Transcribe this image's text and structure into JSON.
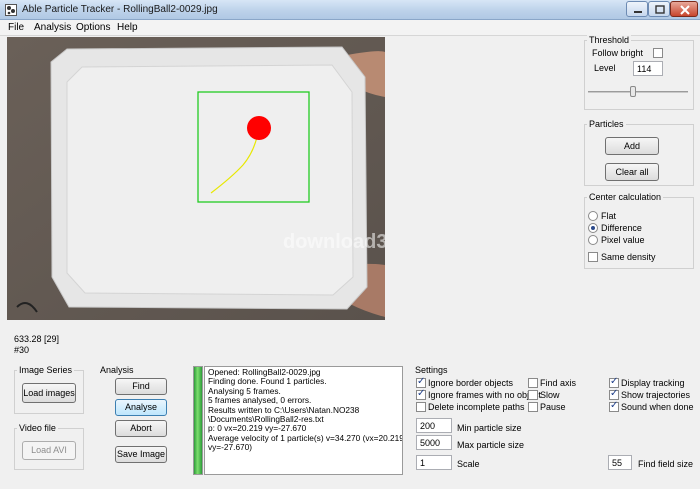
{
  "window": {
    "title": "Able Particle Tracker - RollingBall2-0029.jpg",
    "icon": "app-icon"
  },
  "menu": {
    "items": [
      "File",
      "Analysis",
      "Options",
      "Help"
    ]
  },
  "video": {
    "watermark": "download3k",
    "info_time": "633.28 [29]",
    "info_frame": "#30"
  },
  "threshold": {
    "title": "Threshold",
    "follow_bright_label": "Follow bright",
    "follow_bright_checked": false,
    "level_label": "Level",
    "level_value": "114"
  },
  "particles": {
    "title": "Particles",
    "add_label": "Add",
    "clear_label": "Clear all"
  },
  "center_calc": {
    "title": "Center calculation",
    "options": [
      "Flat",
      "Difference",
      "Pixel value"
    ],
    "selected": "Difference",
    "same_density_label": "Same density",
    "same_density_checked": false
  },
  "image_series": {
    "title": "Image Series",
    "load_label": "Load images"
  },
  "video_file": {
    "title": "Video file",
    "load_label": "Load AVI"
  },
  "analysis": {
    "title": "Analysis",
    "find_label": "Find",
    "analyse_label": "Analyse",
    "abort_label": "Abort",
    "save_label": "Save Image"
  },
  "log_lines": [
    "Opened: RollingBall2-0029.jpg",
    "Finding done. Found 1 particles.",
    "Analysing 5 frames.",
    "5 frames analysed, 0 errors.",
    "Results written to C:\\Users\\Natan.NO238",
    "\\Documents\\RollingBall2-res.txt",
    "p: 0 vx=20.219 vy=-27.670",
    "Average velocity of 1 particle(s) v=34.270 (vx=20.219",
    "vy=-27.670)"
  ],
  "settings": {
    "title": "Settings",
    "checkboxes": [
      {
        "label": "Ignore border objects",
        "checked": true
      },
      {
        "label": "Ignore frames with no object",
        "checked": true
      },
      {
        "label": "Delete incomplete paths",
        "checked": false
      },
      {
        "label": "Find axis",
        "checked": false
      },
      {
        "label": "Slow",
        "checked": false
      },
      {
        "label": "Pause",
        "checked": false
      },
      {
        "label": "Display tracking",
        "checked": true
      },
      {
        "label": "Show trajectories",
        "checked": true
      },
      {
        "label": "Sound when done",
        "checked": true
      }
    ],
    "min_size_value": "200",
    "min_size_label": "Min particle size",
    "max_size_value": "5000",
    "max_size_label": "Max particle size",
    "scale_value": "1",
    "scale_label": "Scale",
    "find_field_value": "55",
    "find_field_label": "Find field size"
  },
  "colors": {
    "particle": "#ff0000",
    "tracking_box": "#22cc22",
    "trajectory": "#e8e800",
    "progress": "#3fbf4a"
  }
}
